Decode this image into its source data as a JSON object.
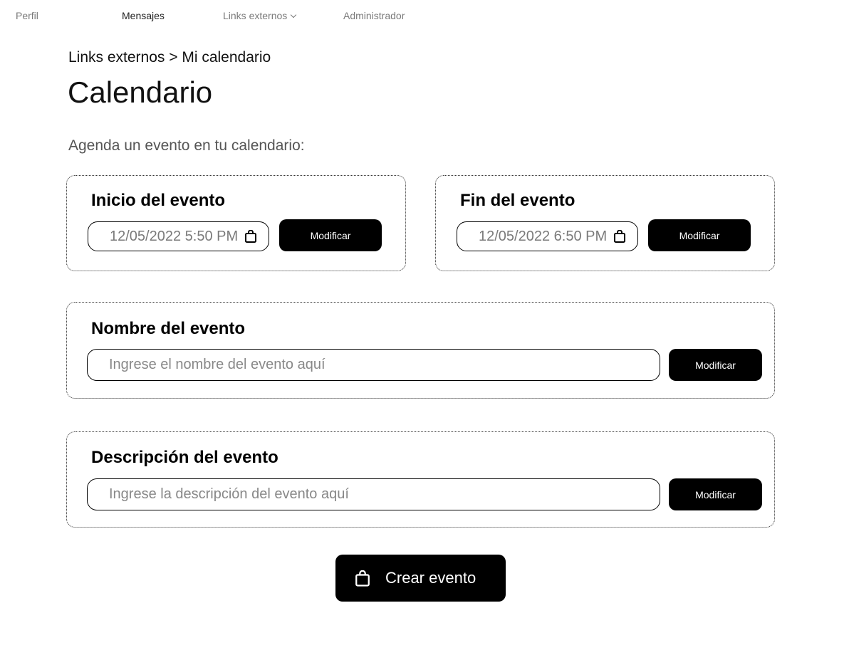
{
  "nav": {
    "items": [
      {
        "label": "Perfil"
      },
      {
        "label": "Mensajes"
      },
      {
        "label": "Links externos"
      },
      {
        "label": "Administrador"
      }
    ]
  },
  "breadcrumb": {
    "parent": "Links externos",
    "separator": " > ",
    "current": "Mi calendario"
  },
  "page": {
    "title": "Calendario",
    "subtitle": "Agenda un evento en tu calendario:"
  },
  "start": {
    "title": "Inicio del evento",
    "value": "12/05/2022 5:50 PM",
    "button": "Modificar"
  },
  "end": {
    "title": "Fin del evento",
    "value": "12/05/2022 6:50 PM",
    "button": "Modificar"
  },
  "name": {
    "title": "Nombre del evento",
    "placeholder": "Ingrese el nombre del evento aquí",
    "button": "Modificar"
  },
  "description": {
    "title": "Descripción del evento",
    "placeholder": "Ingrese la descripción del evento aquí",
    "button": "Modificar"
  },
  "create": {
    "label": "Crear evento",
    "icon": "shopping-bag-icon"
  }
}
